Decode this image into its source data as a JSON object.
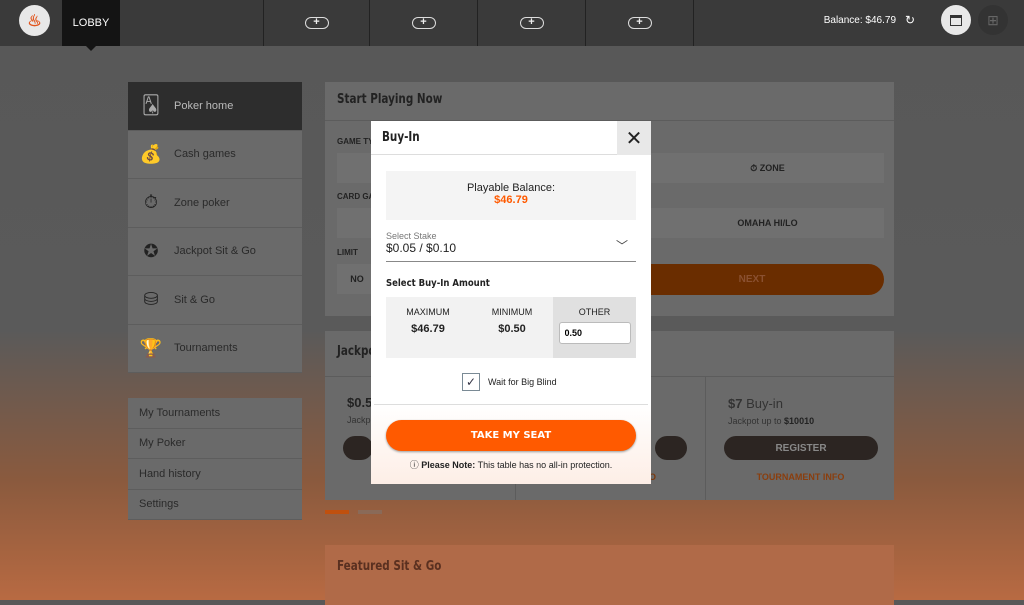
{
  "topbar": {
    "logo": "flame-logo",
    "lobby": "LOBBY",
    "slots": [
      "+",
      "+",
      "+",
      "+"
    ],
    "balance": "Balance: $46.79"
  },
  "sidebar": {
    "items": [
      {
        "label": "Poker home",
        "icon": "cards-icon",
        "glyph": "🂡"
      },
      {
        "label": "Cash games",
        "icon": "coins-icon",
        "glyph": "💰"
      },
      {
        "label": "Zone poker",
        "icon": "stopwatch-icon",
        "glyph": "⏱"
      },
      {
        "label": "Jackpot Sit & Go",
        "icon": "jackpot-chip-icon",
        "glyph": "✪"
      },
      {
        "label": "Sit & Go",
        "icon": "chip-stack-icon",
        "glyph": "⛁"
      },
      {
        "label": "Tournaments",
        "icon": "trophy-icon",
        "glyph": "🏆"
      }
    ],
    "links": [
      "My Tournaments",
      "My Poker",
      "Hand history",
      "Settings"
    ]
  },
  "main": {
    "start_title": "Start Playing Now",
    "game_type": "GAME TY",
    "zone": "ZONE",
    "card_game": "CARD GA",
    "omaha": "OMAHA HI/LO",
    "limit": "LIMIT",
    "no": "NO",
    "next": "NEXT",
    "jackpot_title": "Jackpo",
    "card1_price": "$0.5",
    "card1_sub": "Jackp",
    "card3_price": "$7",
    "card3_buyin": " Buy-in",
    "card3_sub": "Jackpot up to ",
    "card3_amount": "$10010",
    "register": "REGISTER",
    "tournament_info": "TOURNAMENT INFO",
    "card2_info": "O",
    "featured_title": "Featured Sit & Go"
  },
  "modal": {
    "title": "Buy-In",
    "playable_label": "Playable Balance:",
    "playable_value": "$46.79",
    "stake_label": "Select Stake",
    "stake_value": "$0.05 / $0.10",
    "buyin_label": "Select Buy-In Amount",
    "max_label": "MAXIMUM",
    "max_value": "$46.79",
    "min_label": "MINIMUM",
    "min_value": "$0.50",
    "other_label": "OTHER",
    "other_value": "0.50",
    "wait_label": "Wait for Big Blind",
    "wait_checked": true,
    "take_seat": "TAKE MY SEAT",
    "note_bold": "Please Note:",
    "note_text": " This table has no all-in protection."
  },
  "colors": {
    "accent": "#ff5a00"
  }
}
